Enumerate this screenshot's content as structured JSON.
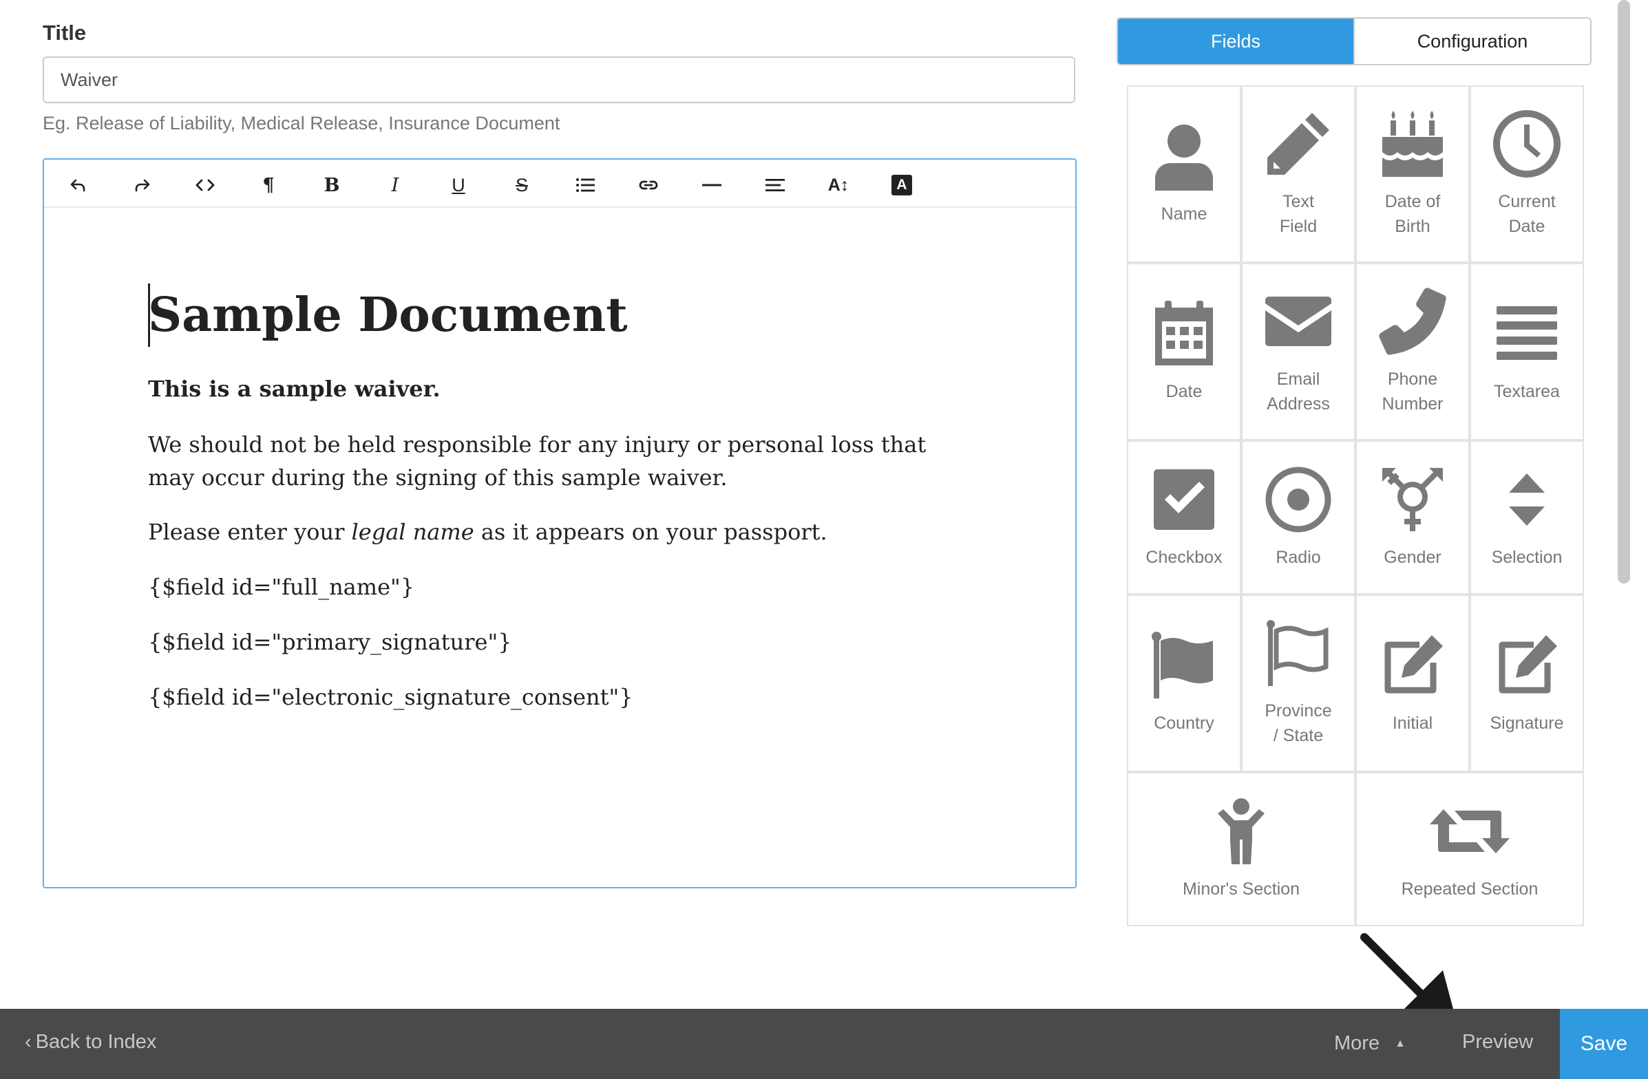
{
  "form": {
    "title_label": "Title",
    "title_value": "Waiver",
    "title_hint": "Eg. Release of Liability, Medical Release, Insurance Document"
  },
  "toolbar": {
    "buttons": [
      "undo",
      "redo",
      "code",
      "paragraph",
      "bold",
      "italic",
      "underline",
      "strikethrough",
      "list",
      "link",
      "horizontal-rule",
      "align",
      "font-size",
      "text-color"
    ],
    "bold_glyph": "B",
    "italic_glyph": "I",
    "underline_glyph": "U",
    "strike_glyph": "S",
    "paragraph_glyph": "¶",
    "code_glyph": "<>",
    "fontsize_glyph": "A↕",
    "color_glyph": "A"
  },
  "document": {
    "heading": "Sample Document",
    "intro_bold": "This is a sample waiver.",
    "para1": "We should not be held responsible for any injury or personal loss that may occur during the signing of this sample waiver.",
    "para2_before": "Please enter your ",
    "para2_italic": "legal name",
    "para2_after": " as it appears on your passport.",
    "field1": "{$field id=\"full_name\"}",
    "field2": "{$field id=\"primary_signature\"}",
    "field3": "{$field id=\"electronic_signature_consent\"}"
  },
  "tabs": {
    "fields": "Fields",
    "configuration": "Configuration"
  },
  "palette": {
    "icon_color": "#7a7a7a",
    "items": [
      {
        "label": "Name",
        "icon": "user-icon"
      },
      {
        "label": "Text\nField",
        "icon": "pencil-icon"
      },
      {
        "label": "Date of\nBirth",
        "icon": "birthday-cake-icon"
      },
      {
        "label": "Current\nDate",
        "icon": "clock-icon"
      },
      {
        "label": "Date",
        "icon": "calendar-icon"
      },
      {
        "label": "Email\nAddress",
        "icon": "envelope-icon"
      },
      {
        "label": "Phone\nNumber",
        "icon": "phone-icon"
      },
      {
        "label": "Textarea",
        "icon": "bars-icon"
      },
      {
        "label": "Checkbox",
        "icon": "checkbox-icon"
      },
      {
        "label": "Radio",
        "icon": "radio-icon"
      },
      {
        "label": "Gender",
        "icon": "transgender-icon"
      },
      {
        "label": "Selection",
        "icon": "sort-icon"
      },
      {
        "label": "Country",
        "icon": "flag-icon"
      },
      {
        "label": "Province\n/ State",
        "icon": "flag-outline-icon"
      },
      {
        "label": "Initial",
        "icon": "edit-icon"
      },
      {
        "label": "Signature",
        "icon": "edit-icon"
      },
      {
        "label": "Minor's Section",
        "icon": "child-icon"
      },
      {
        "label": "Repeated Section",
        "icon": "retweet-icon"
      }
    ]
  },
  "footer": {
    "back": "Back to Index",
    "more": "More",
    "preview": "Preview",
    "save": "Save"
  },
  "colors": {
    "accent": "#2f9ae0",
    "footer_bg": "#4a4a4a",
    "footer_text": "#c8c8c8"
  }
}
